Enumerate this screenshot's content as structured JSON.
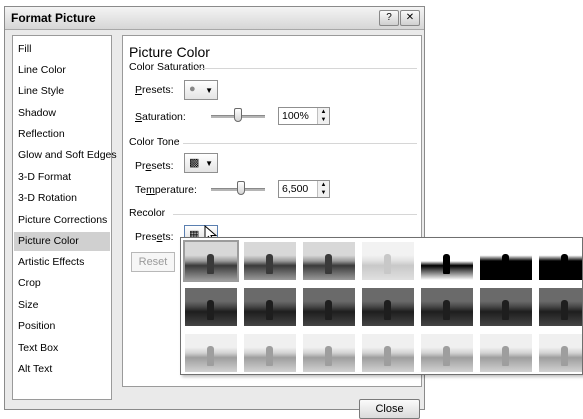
{
  "dialog": {
    "title": "Format Picture",
    "help_label": "?",
    "close_icon_label": "✕",
    "close_button": "Close"
  },
  "sidebar": {
    "items": [
      {
        "label": "Fill"
      },
      {
        "label": "Line Color"
      },
      {
        "label": "Line Style"
      },
      {
        "label": "Shadow"
      },
      {
        "label": "Reflection"
      },
      {
        "label": "Glow and Soft Edges"
      },
      {
        "label": "3-D Format"
      },
      {
        "label": "3-D Rotation"
      },
      {
        "label": "Picture Corrections"
      },
      {
        "label": "Picture Color",
        "selected": true
      },
      {
        "label": "Artistic Effects"
      },
      {
        "label": "Crop"
      },
      {
        "label": "Size"
      },
      {
        "label": "Position"
      },
      {
        "label": "Text Box"
      },
      {
        "label": "Alt Text"
      }
    ]
  },
  "panel": {
    "title": "Picture Color",
    "saturation": {
      "group": "Color Saturation",
      "presets_first": "P",
      "presets_rest": "resets:",
      "label_first": "S",
      "label_rest": "aturation:",
      "value": "100%",
      "level": 0.5
    },
    "tone": {
      "group": "Color Tone",
      "presets_pre": "Pr",
      "presets_u": "e",
      "presets_post": "sets:",
      "label_pre": "Te",
      "label_u": "m",
      "label_post": "perature:",
      "value": "6,500",
      "level": 0.55
    },
    "recolor": {
      "group": "Recolor",
      "presets_pre": "Pres",
      "presets_u": "e",
      "presets_post": "ts:",
      "reset_label": "Reset"
    }
  },
  "gallery": {
    "rows": [
      {
        "style": "grayscale",
        "count": 7
      },
      {
        "style": "dark",
        "count": 7
      },
      {
        "style": "washout",
        "count": 7
      }
    ]
  },
  "colors": {
    "selected_bg": "#d0d0d0",
    "panel_bg": "#ffffff",
    "dialog_bg": "#eaeaea"
  }
}
